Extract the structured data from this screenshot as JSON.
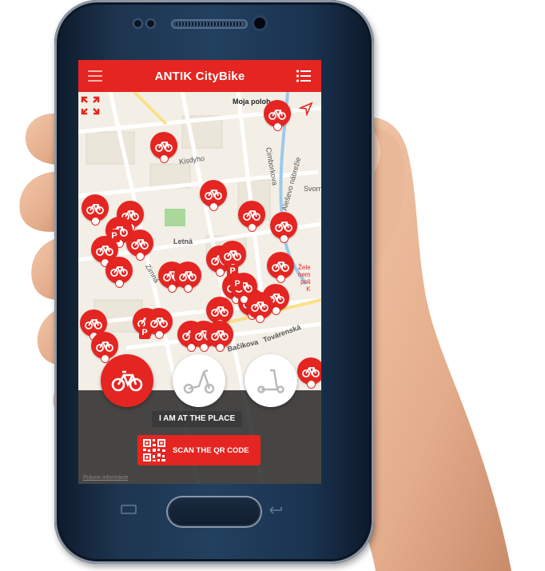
{
  "app": {
    "title": "ANTIK CityBike",
    "brand_color": "#e52521"
  },
  "map": {
    "my_location_label": "Moja poloh",
    "street_labels": [
      "Letná",
      "Továrenská",
      "Bačíkova",
      "Kisdyho",
      "Zimná",
      "Cimborkova",
      "Aleševo nábrežie",
      "Svorn"
    ],
    "poi_text": [
      "Žele",
      "nem",
      "poli",
      "K"
    ],
    "attribution": "Právne informácie"
  },
  "modes": [
    {
      "name": "bike",
      "active": true,
      "icon": "bicycle-icon"
    },
    {
      "name": "kick-bike",
      "active": false,
      "icon": "kick-bike-icon"
    },
    {
      "name": "scooter",
      "active": false,
      "icon": "scooter-icon"
    }
  ],
  "actions": {
    "place_label": "I AM AT THE PLACE",
    "scan_label": "SCAN THE QR CODE",
    "scan_icon": "qr-code-icon"
  },
  "icons": {
    "menu": "hamburger-icon",
    "list": "list-icon",
    "expand": "expand-icon",
    "compass": "compass-arrow-icon"
  }
}
